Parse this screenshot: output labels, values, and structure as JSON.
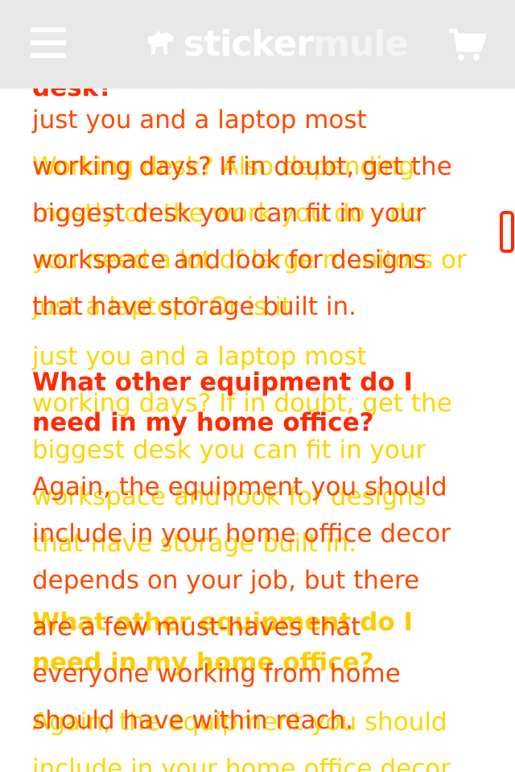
{
  "header": {
    "logo_text_primary": "sticker",
    "logo_text_secondary": "mule",
    "menu_icon": "hamburger-menu-icon",
    "cart_icon": "shopping-cart-icon",
    "background": "#e8e8e8"
  },
  "colors": {
    "layer_a_text": "#ff4a00",
    "layer_a_heading": "#ff2a00",
    "layer_b_text": "#ffd500",
    "scroll_indicator": "#ff2a00"
  },
  "layer_a": {
    "top_fragment": "desk?",
    "para1": "just you and a laptop most\nworking days? If in doubt, get the\nbiggest desk you can fit in your\nworkspace and look for designs\nthat have storage built in.",
    "heading1": "What other equipment do I\nneed in my home office?",
    "para2": "Again, the equipment you should\ninclude in your home office decor\ndepends on your job, but there\nare a few must-haves that\neveryone working from home\nshould have within reach."
  },
  "layer_b": {
    "para1": "Working desk? Also depending\nmostly on the work you do - do\nyou need a lot of large monitors or\njust a laptop? Or is it",
    "para2": "just you and a laptop most\nworking days? If in doubt, get the\nbiggest desk you can fit in your\nworkspace and look for designs\nthat have storage built in.",
    "heading1": "What other equipment do I\nneed in my home office?",
    "para3": "Again, the equipment you should\ninclude in your home office decor"
  }
}
